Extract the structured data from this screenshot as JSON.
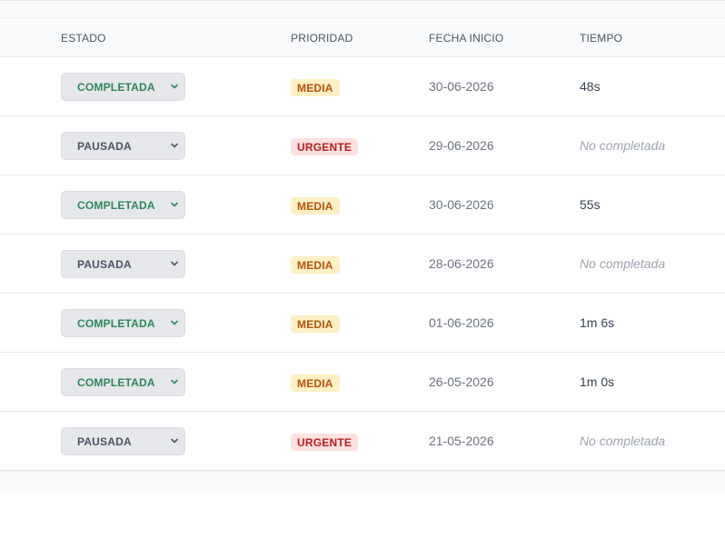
{
  "header": {
    "estado": "ESTADO",
    "prioridad": "PRIORIDAD",
    "fecha_inicio": "FECHA INICIO",
    "tiempo": "TIEMPO"
  },
  "colors": {
    "completada_text": "#2f855a",
    "pausada_text": "#4b5563",
    "media_bg": "#fdf0c4",
    "media_text": "#b45309",
    "urgente_bg": "#fde0e0",
    "urgente_text": "#b91c1c"
  },
  "rows": [
    {
      "estado": "COMPLETADA",
      "prioridad": "MEDIA",
      "fecha": "30-06-2026",
      "tiempo": "48s"
    },
    {
      "estado": "PAUSADA",
      "prioridad": "URGENTE",
      "fecha": "29-06-2026",
      "tiempo": "No completada"
    },
    {
      "estado": "COMPLETADA",
      "prioridad": "MEDIA",
      "fecha": "30-06-2026",
      "tiempo": "55s"
    },
    {
      "estado": "PAUSADA",
      "prioridad": "MEDIA",
      "fecha": "28-06-2026",
      "tiempo": "No completada"
    },
    {
      "estado": "COMPLETADA",
      "prioridad": "MEDIA",
      "fecha": "01-06-2026",
      "tiempo": "1m 6s"
    },
    {
      "estado": "COMPLETADA",
      "prioridad": "MEDIA",
      "fecha": "26-05-2026",
      "tiempo": "1m 0s"
    },
    {
      "estado": "PAUSADA",
      "prioridad": "URGENTE",
      "fecha": "21-05-2026",
      "tiempo": "No completada"
    }
  ]
}
